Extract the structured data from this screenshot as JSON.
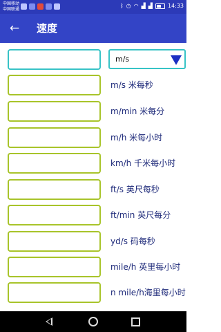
{
  "status_bar": {
    "carrier_line1": "中国移动",
    "carrier_line2": "中国联通",
    "time": "14:33"
  },
  "app_bar": {
    "back_icon": "arrow-left-icon",
    "title": "速度"
  },
  "converter": {
    "input_value": "",
    "selected_unit": "m/s",
    "colors": {
      "accent_border": "#37c3c6",
      "field_border": "#a8c42a",
      "arrow": "#1c2fc2",
      "label": "#1e2a7a"
    }
  },
  "units": [
    {
      "label": "m/s    米每秒",
      "value": ""
    },
    {
      "label": "m/min 米每分",
      "value": ""
    },
    {
      "label": "m/h    米每小时",
      "value": ""
    },
    {
      "label": "km/h  千米每小时",
      "value": ""
    },
    {
      "label": "ft/s     英尺每秒",
      "value": ""
    },
    {
      "label": "ft/min 英尺每分",
      "value": ""
    },
    {
      "label": "yd/s    码每秒",
      "value": ""
    },
    {
      "label": "mile/h  英里每小时",
      "value": ""
    },
    {
      "label": "n mile/h海里每小时",
      "value": ""
    }
  ]
}
